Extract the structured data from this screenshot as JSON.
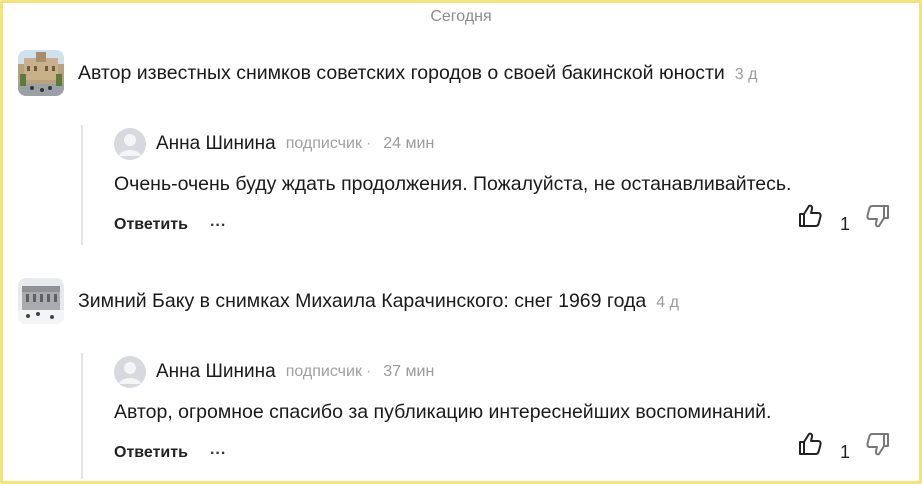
{
  "day_label": "Сегодня",
  "items": [
    {
      "article": {
        "title": "Автор известных снимков советских городов о своей бакинской юности",
        "age": "3 д"
      },
      "comment": {
        "author": "Анна Шинина",
        "role": "подписчик",
        "separator": "·",
        "time": "24 мин",
        "text": "Очень-очень буду ждать продолжения. Пожалуйста, не останавливайтесь.",
        "reply_label": "Ответить",
        "more_label": "...",
        "likes": "1"
      }
    },
    {
      "article": {
        "title": "Зимний Баку в снимках Михаила Карачинского: снег 1969 года",
        "age": "4 д"
      },
      "comment": {
        "author": "Анна Шинина",
        "role": "подписчик",
        "separator": "·",
        "time": "37 мин",
        "text": "Автор, огромное спасибо за публикацию интереснейших воспоминаний.",
        "reply_label": "Ответить",
        "more_label": "...",
        "likes": "1"
      }
    }
  ]
}
